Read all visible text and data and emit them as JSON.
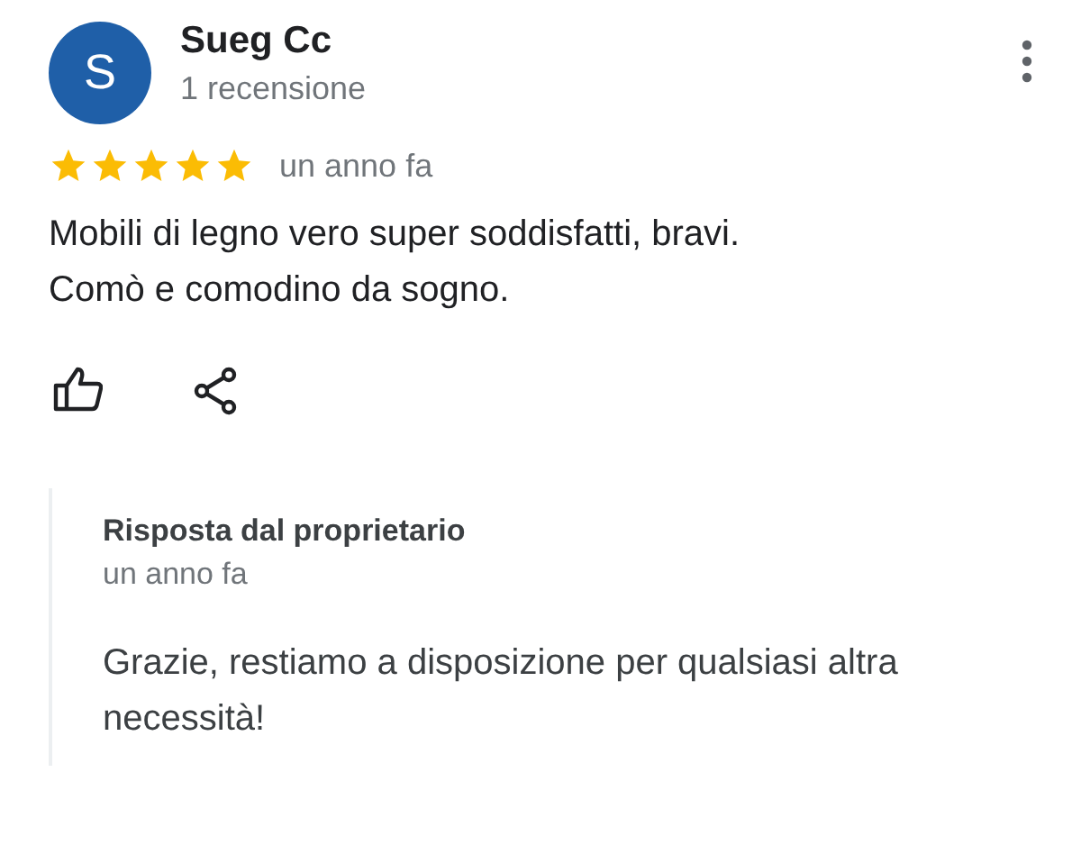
{
  "review": {
    "avatar_letter": "S",
    "author": "Sueg Cc",
    "review_count": "1 recensione",
    "stars": 5,
    "time": "un anno fa",
    "text": "Mobili di legno vero super soddisfatti, bravi.\nComò e comodino da sogno."
  },
  "owner_reply": {
    "title": "Risposta dal proprietario",
    "time": "un anno fa",
    "text": "Grazie, restiamo a disposizione per qualsiasi altra necessità!"
  }
}
